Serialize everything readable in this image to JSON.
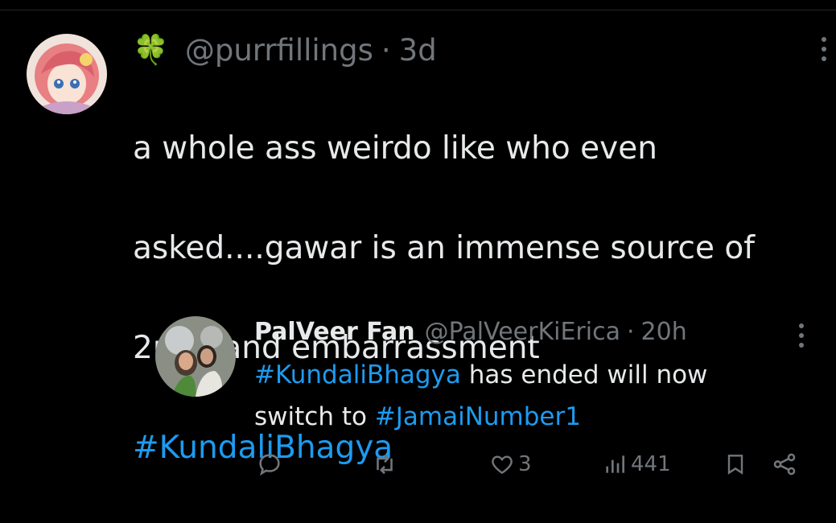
{
  "main_tweet": {
    "handle": "@purrfillings",
    "separator": "·",
    "time": "3d",
    "emoji": "🍀",
    "text_lines": [
      "a whole ass weirdo like who even",
      "asked....gawar is an immense source of",
      "2nd hand embarrassment"
    ],
    "hashtag": "#KundaliBhagya"
  },
  "reply_tweet": {
    "display_name": "PalVeer Fan",
    "handle": "@PalVeerKiErica",
    "separator": "·",
    "time": "20h",
    "hashtag1": "#KundaliBhagya",
    "text_mid": " has ended will now",
    "text_line2_prefix": "switch to ",
    "hashtag2": "#JamaiNumber1"
  },
  "actions": {
    "reply_icon": "reply-icon",
    "retweet_icon": "retweet-icon",
    "like_icon": "heart-icon",
    "like_count": "3",
    "views_icon": "views-icon",
    "views_count": "441",
    "bookmark_icon": "bookmark-icon",
    "share_icon": "share-icon"
  },
  "colors": {
    "background": "#000000",
    "text": "#e7e9ea",
    "muted": "#71767b",
    "link": "#1d9bf0"
  }
}
